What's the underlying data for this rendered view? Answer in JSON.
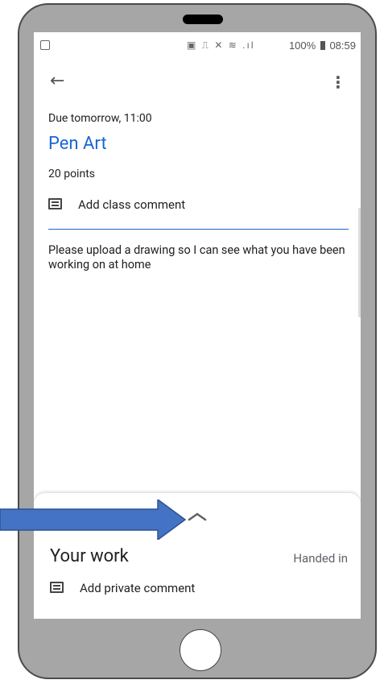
{
  "status_bar": {
    "icons": "▣ ⎍ ✕ ≋ .ıl",
    "battery": "100%",
    "time": "08:59"
  },
  "toolbar": {
    "back_glyph": "←",
    "menu_glyph": "⋮"
  },
  "assignment": {
    "due": "Due tomorrow, 11:00",
    "title": "Pen Art",
    "points": "20 points",
    "class_comment_label": "Add class comment",
    "description": "Please upload a drawing so I can see what you have been working on at home"
  },
  "your_work": {
    "heading": "Your work",
    "status": "Handed in",
    "private_comment_label": "Add private comment"
  },
  "colors": {
    "accent": "#1967d2",
    "arrow": "#4472c4",
    "phone_body": "#a6a6a6"
  },
  "icons": [
    "back-arrow-icon",
    "more-vert-icon",
    "comment-icon",
    "chevron-up-icon",
    "annotation-arrow-icon"
  ]
}
